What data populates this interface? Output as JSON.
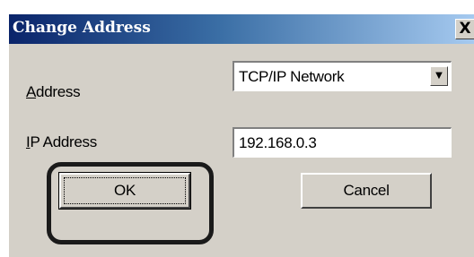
{
  "dialog": {
    "title": "Change Address",
    "close_label": "X"
  },
  "form": {
    "address_label_accel": "A",
    "address_label_rest": "ddress",
    "address_selected": "TCP/IP Network",
    "ip_label_accel": "I",
    "ip_label_rest": "P Address",
    "ip_value": "192.168.0.3"
  },
  "buttons": {
    "ok_label": "OK",
    "cancel_label": "Cancel"
  },
  "colors": {
    "titlebar_start": "#0a246a",
    "titlebar_end": "#a6caf0",
    "dialog_face": "#d4d0c8",
    "highlight_outline": "#1a1a1a"
  },
  "icons": {
    "dropdown": "chevron-down-icon",
    "close": "close-icon"
  }
}
